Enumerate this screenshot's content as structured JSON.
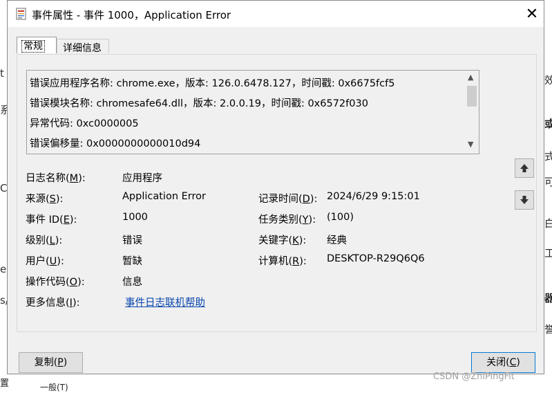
{
  "window": {
    "title": "事件属性 - 事件 1000，Application Error",
    "close_glyph": "✕"
  },
  "tabs": [
    {
      "label": "常规",
      "active": true
    },
    {
      "label": "详细信息",
      "active": false
    }
  ],
  "description": {
    "lines": [
      "错误应用程序名称: chrome.exe，版本: 126.0.6478.127，时间戳: 0x6675fcf5",
      "错误模块名称: chromesafe64.dll，版本: 2.0.0.19，时间戳: 0x6572f030",
      "异常代码: 0xc0000005",
      "错误偏移量: 0x0000000000010d94"
    ]
  },
  "fields": {
    "log_name": {
      "label_pre": "日志名称(",
      "key": "M",
      "label_post": "):",
      "value": "应用程序"
    },
    "source": {
      "label_pre": "来源(",
      "key": "S",
      "label_post": "):",
      "value": "Application Error"
    },
    "logged": {
      "label_pre": "记录时间(",
      "key": "D",
      "label_post": "):",
      "value": "2024/6/29 9:15:01"
    },
    "event_id": {
      "label_pre": "事件 ID(",
      "key": "E",
      "label_post": "):",
      "value": "1000"
    },
    "task_category": {
      "label_pre": "任务类别(",
      "key": "Y",
      "label_post": "):",
      "value": "(100)"
    },
    "level": {
      "label_pre": "级别(",
      "key": "L",
      "label_post": "):",
      "value": "错误"
    },
    "keywords": {
      "label_pre": "关键字(",
      "key": "K",
      "label_post": "):",
      "value": "经典"
    },
    "user": {
      "label_pre": "用户(",
      "key": "U",
      "label_post": "):",
      "value": "暂缺"
    },
    "computer": {
      "label_pre": "计算机(",
      "key": "R",
      "label_post": "):",
      "value": "DESKTOP-R29Q6Q6"
    },
    "opcode": {
      "label_pre": "操作代码(",
      "key": "O",
      "label_post": "):",
      "value": "信息"
    },
    "more_info": {
      "label_pre": "更多信息(",
      "key": "I",
      "label_post": "):",
      "value": "事件日志联机帮助"
    }
  },
  "buttons": {
    "copy": {
      "pre": "复制(",
      "key": "P",
      "post": ")"
    },
    "close": {
      "pre": "关闭(",
      "key": "C",
      "post": ")"
    },
    "up_glyph": "🡅",
    "down_glyph": "🡇"
  },
  "background": {
    "left_chars": [
      "t",
      "系",
      "C",
      "e",
      "s/"
    ],
    "right_chars": [
      "效",
      "或",
      "式",
      "可",
      "白",
      "工",
      "器",
      "誉"
    ],
    "bottom_left": "置",
    "bottom_mid": "一般(T)",
    "watermark": "CSDN @ZhiPingFit"
  }
}
